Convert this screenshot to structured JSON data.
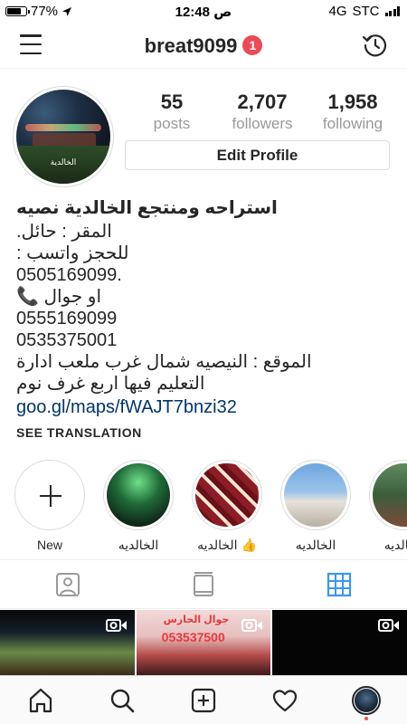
{
  "status_bar": {
    "battery": "77%",
    "time": "12:48 ص",
    "network": "4G",
    "carrier": "STC"
  },
  "header": {
    "username": "breat9099",
    "notification_count": "1",
    "icons": [
      "menu-icon",
      "history-icon"
    ]
  },
  "profile": {
    "avatar_caption": "الخالدية",
    "stats": [
      {
        "value": "55",
        "label": "posts"
      },
      {
        "value": "2,707",
        "label": "followers"
      },
      {
        "value": "1,958",
        "label": "following"
      }
    ],
    "edit_profile_label": "Edit Profile"
  },
  "bio": {
    "name": "استراحه ومنتجع الخالدية  نصيه",
    "lines": [
      "المقر : حائل.",
      "للحجز واتسب :",
      "0505169099.",
      "او جوال 📞",
      "0555169099",
      "0535375001",
      "الموقع : النيصيه شمال غرب ملعب ادارة",
      "التعليم فيها اربع غرف نوم"
    ],
    "link": "goo.gl/maps/fWAJT7bnzi32",
    "see_translation": "SEE TRANSLATION"
  },
  "highlights": [
    {
      "label": "New",
      "type": "new"
    },
    {
      "label": "الخالديه",
      "type": "image"
    },
    {
      "label": "الخالديه 👍",
      "type": "image"
    },
    {
      "label": "الخالديه",
      "type": "image"
    },
    {
      "label": "الخالديه",
      "type": "image"
    }
  ],
  "tabs": {
    "items": [
      "tagged-icon",
      "feed-icon",
      "grid-icon"
    ],
    "active": "grid-icon",
    "active_color": "#3897f0"
  },
  "grid": {
    "cell_2_text": "جوال الحارس",
    "cell_2_number": "053537500"
  },
  "bottom_nav": {
    "items": [
      "home-icon",
      "search-icon",
      "add-post-icon",
      "heart-icon",
      "profile-avatar"
    ]
  }
}
